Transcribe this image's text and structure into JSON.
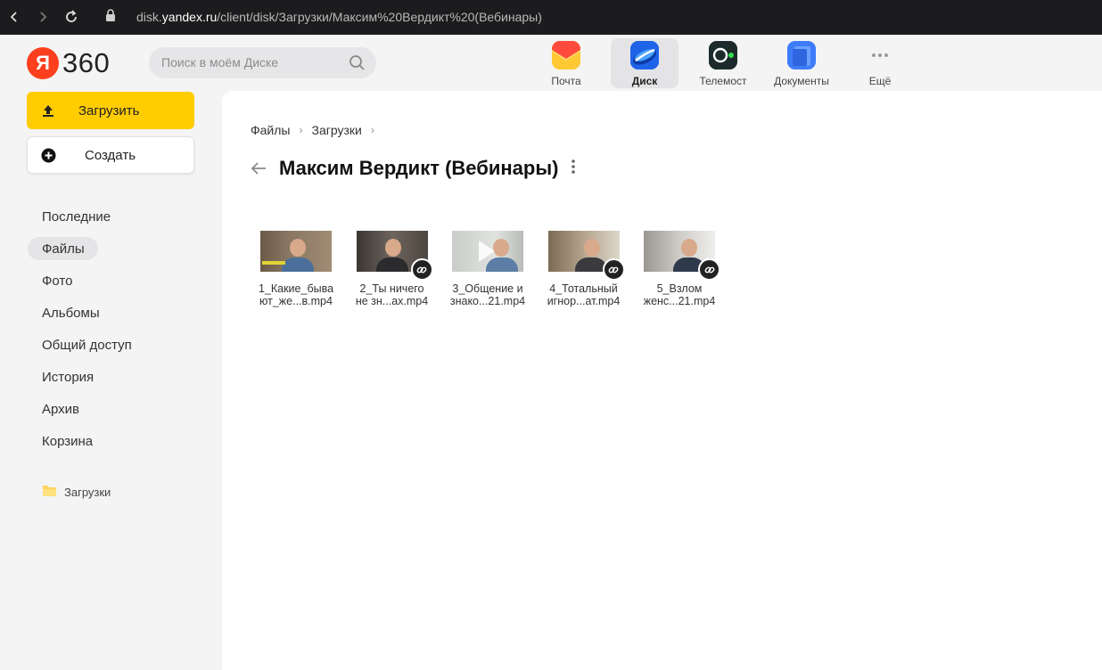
{
  "browser": {
    "url_prefix": "disk.",
    "url_host": "yandex.ru",
    "url_path": "/client/disk/Загрузки/Максим%20Вердикт%20(Вебинары)"
  },
  "header": {
    "logo_letter": "Я",
    "logo_text": "360",
    "search_placeholder": "Поиск в моём Диске",
    "services": [
      {
        "label": "Почта",
        "icon": "mail-icon"
      },
      {
        "label": "Диск",
        "icon": "disk-icon",
        "active": true
      },
      {
        "label": "Телемост",
        "icon": "telemost-icon"
      },
      {
        "label": "Документы",
        "icon": "documents-icon"
      },
      {
        "label": "Ещё",
        "icon": "more-icon"
      }
    ]
  },
  "sidebar": {
    "upload_label": "Загрузить",
    "create_label": "Создать",
    "nav": [
      {
        "label": "Последние"
      },
      {
        "label": "Файлы",
        "active": true
      },
      {
        "label": "Фото"
      },
      {
        "label": "Альбомы"
      },
      {
        "label": "Общий доступ"
      },
      {
        "label": "История"
      },
      {
        "label": "Архив"
      },
      {
        "label": "Корзина"
      }
    ],
    "folder_label": "Загрузки"
  },
  "main": {
    "breadcrumb": [
      "Файлы",
      "Загрузки"
    ],
    "title": "Максим Вердикт (Вебинары)",
    "files": [
      {
        "line1": "1_Какие_быва",
        "line2": "ют_же...в.mp4",
        "shared": false
      },
      {
        "line1": "2_Ты ничего",
        "line2": "не зн...ах.mp4",
        "shared": true
      },
      {
        "line1": "3_Общение и",
        "line2": "знако...21.mp4",
        "shared": false
      },
      {
        "line1": "4_Тотальный",
        "line2": "игнор...ат.mp4",
        "shared": true
      },
      {
        "line1": "5_Взлом",
        "line2": "женс...21.mp4",
        "shared": true
      }
    ]
  },
  "colors": {
    "accent_yellow": "#ffcc00",
    "logo_red": "#fc3f1d",
    "browser_bar": "#1c1c1e"
  }
}
